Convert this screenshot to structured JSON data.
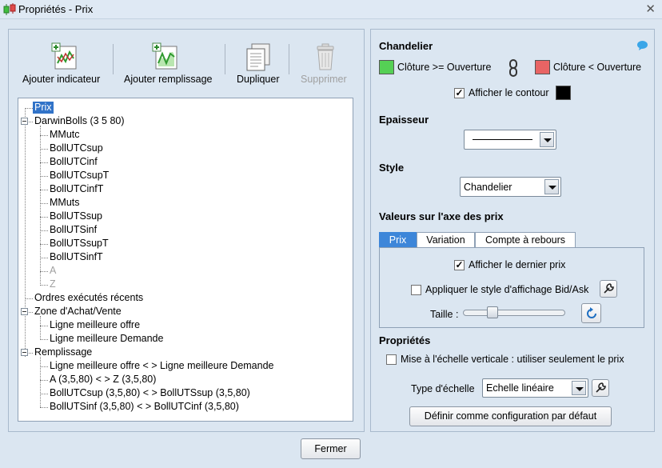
{
  "window": {
    "title": "Propriétés - Prix",
    "close_glyph": "✕",
    "app_icon": "candlestick-chart-icon"
  },
  "toolbar": {
    "add_indicator": "Ajouter indicateur",
    "add_fill": "Ajouter remplissage",
    "duplicate": "Dupliquer",
    "delete": "Supprimer"
  },
  "tree": [
    {
      "label": "Prix",
      "selected": true
    },
    {
      "label": "DarwinBolls (3 5 80)",
      "expanded": true
    },
    {
      "label": "MMutc"
    },
    {
      "label": "BollUTCsup"
    },
    {
      "label": "BollUTCinf"
    },
    {
      "label": "BollUTCsupT"
    },
    {
      "label": "BollUTCinfT"
    },
    {
      "label": "MMuts"
    },
    {
      "label": "BollUTSsup"
    },
    {
      "label": "BollUTSinf"
    },
    {
      "label": "BollUTSsupT"
    },
    {
      "label": "BollUTSinfT"
    },
    {
      "label": "A",
      "disabled": true
    },
    {
      "label": "Z",
      "disabled": true
    },
    {
      "label": "Ordres exécutés récents"
    },
    {
      "label": "Zone d'Achat/Vente",
      "expanded": true
    },
    {
      "label": "Ligne meilleure offre"
    },
    {
      "label": "Ligne meilleure Demande"
    },
    {
      "label": "Remplissage",
      "expanded": true
    },
    {
      "label": "Ligne meilleure offre < > Ligne meilleure Demande"
    },
    {
      "label": "A (3,5,80) < > Z (3,5,80)"
    },
    {
      "label": "BollUTCsup (3,5,80) < > BollUTSsup (3,5,80)"
    },
    {
      "label": "BollUTSinf (3,5,80) < > BollUTCinf (3,5,80)"
    }
  ],
  "right": {
    "candle_heading": "Chandelier",
    "close_ge_open": "Clôture >= Ouverture",
    "close_lt_open": "Clôture < Ouverture",
    "show_outline": "Afficher le contour",
    "thickness_heading": "Epaisseur",
    "style_heading": "Style",
    "style_value": "Chandelier",
    "price_axis_heading": "Valeurs sur l'axe des prix",
    "tabs": [
      "Prix",
      "Variation",
      "Compte à rebours"
    ],
    "show_last_price": "Afficher le dernier prix",
    "bid_ask_style": "Appliquer le style d'affichage Bid/Ask",
    "size_label": "Taille :",
    "properties_heading": "Propriétés",
    "vertical_scale": "Mise à l'échelle verticale : utiliser seulement le prix",
    "scale_type_label": "Type d'échelle",
    "scale_type_value": "Echelle linéaire",
    "default_button": "Définir comme configuration par défaut"
  },
  "footer": {
    "close_button": "Fermer"
  },
  "colors": {
    "up_color": "#55d055",
    "down_color": "#e86464",
    "outline_color": "#000000",
    "selection": "#3173c8"
  },
  "states": {
    "show_outline_checked": true,
    "show_last_price_checked": true,
    "bid_ask_checked": false,
    "vertical_scale_checked": false,
    "active_tab": "Prix"
  }
}
